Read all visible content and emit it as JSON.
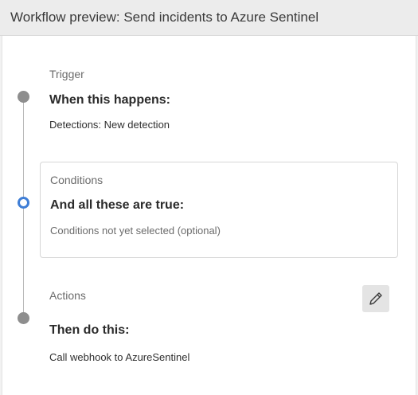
{
  "header": {
    "title": "Workflow preview: Send incidents to Azure Sentinel"
  },
  "steps": {
    "trigger": {
      "label": "Trigger",
      "heading": "When this happens:",
      "detail": "Detections: New detection"
    },
    "conditions": {
      "label": "Conditions",
      "heading": "And all these are true:",
      "detail": "Conditions not yet selected (optional)"
    },
    "actions": {
      "label": "Actions",
      "heading": "Then do this:",
      "detail": "Call webhook to AzureSentinel",
      "edit_icon": "pencil-icon"
    }
  },
  "colors": {
    "active_step": "#3f7ed6",
    "inactive_step": "#8e8e8e"
  }
}
